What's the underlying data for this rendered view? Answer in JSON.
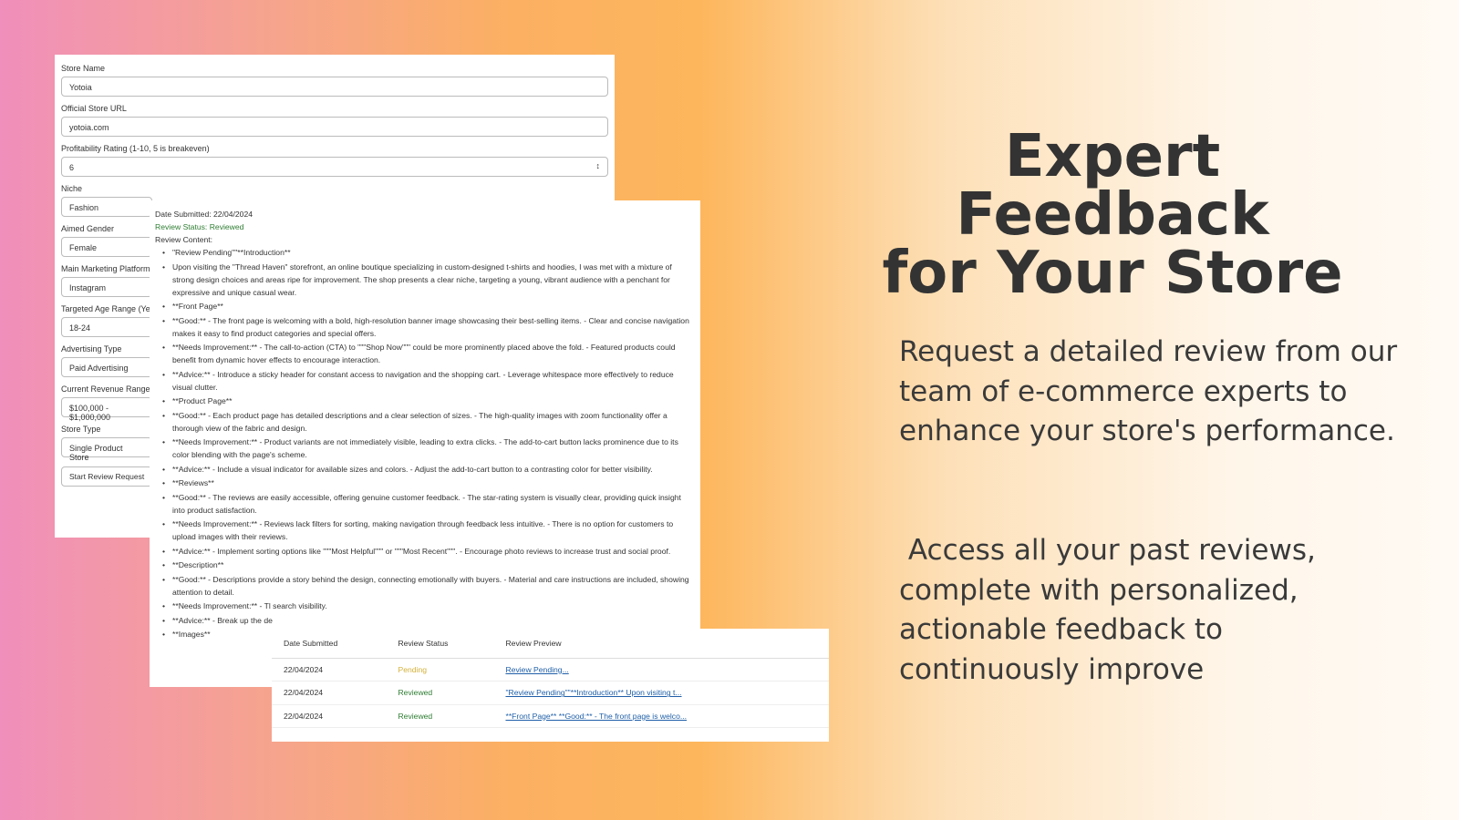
{
  "form": {
    "fields": [
      {
        "label": "Store Name",
        "value": "Yotoia"
      },
      {
        "label": "Official Store URL",
        "value": "yotoia.com"
      },
      {
        "label": "Profitability Rating (1-10, 5 is breakeven)",
        "value": "6"
      },
      {
        "label": "Niche",
        "value": "Fashion"
      },
      {
        "label": "Aimed Gender",
        "value": "Female"
      },
      {
        "label": "Main Marketing Platform",
        "value": "Instagram"
      },
      {
        "label": "Targeted Age Range (Ye",
        "value": "18-24"
      },
      {
        "label": "Advertising Type",
        "value": "Paid Advertising"
      },
      {
        "label": "Current Revenue Range",
        "value": "$100,000 - $1,000,000"
      },
      {
        "label": "Store Type",
        "value": "Single Product Store"
      }
    ],
    "submit_label": "Start Review Request"
  },
  "review": {
    "date": "Date Submitted: 22/04/2024",
    "status": "Review Status: Reviewed",
    "content_label": "Review Content:",
    "items": [
      "\"Review Pending\"\"**Introduction**",
      "Upon visiting the \"Thread Haven\" storefront, an online boutique specializing in custom-designed t-shirts and hoodies, I was met with a mixture of strong design choices and areas ripe for improvement. The shop presents a clear niche, targeting a young, vibrant audience with a penchant for expressive and unique casual wear.",
      "**Front Page**",
      "**Good:** - The front page is welcoming with a bold, high-resolution banner image showcasing their best-selling items. - Clear and concise navigation makes it easy to find product categories and special offers.",
      "**Needs Improvement:** - The call-to-action (CTA) to \"\"\"Shop Now\"\"\" could be more prominently placed above the fold. - Featured products could benefit from dynamic hover effects to encourage interaction.",
      "**Advice:** - Introduce a sticky header for constant access to navigation and the shopping cart. - Leverage whitespace more effectively to reduce visual clutter.",
      "**Product Page**",
      "**Good:** - Each product page has detailed descriptions and a clear selection of sizes. - The high-quality images with zoom functionality offer a thorough view of the fabric and design.",
      "**Needs Improvement:** - Product variants are not immediately visible, leading to extra clicks. - The add-to-cart button lacks prominence due to its color blending with the page's scheme.",
      "**Advice:** - Include a visual indicator for available sizes and colors. - Adjust the add-to-cart button to a contrasting color for better visibility.",
      "**Reviews**",
      "**Good:** - The reviews are easily accessible, offering genuine customer feedback. - The star-rating system is visually clear, providing quick insight into product satisfaction.",
      "**Needs Improvement:** - Reviews lack filters for sorting, making navigation through feedback less intuitive. - There is no option for customers to upload images with their reviews.",
      "**Advice:** - Implement sorting options like \"\"\"Most Helpful\"\"\" or \"\"\"Most Recent\"\"\". - Encourage photo reviews to increase trust and social proof.",
      "**Description**",
      "**Good:** - Descriptions provide a story behind the design, connecting emotionally with buyers. - Material and care instructions are included, showing attention to detail.",
      "**Needs Improvement:** - Tl search visibility.",
      "**Advice:** - Break up the de",
      "**Images**"
    ]
  },
  "table": {
    "headers": [
      "Date Submitted",
      "Review Status",
      "Review Preview"
    ],
    "rows": [
      {
        "date": "22/04/2024",
        "status": "Pending",
        "preview": "Review Pending..."
      },
      {
        "date": "22/04/2024",
        "status": "Reviewed",
        "preview": "\"Review Pending\"\"**Introduction** Upon visiting t..."
      },
      {
        "date": "22/04/2024",
        "status": "Reviewed",
        "preview": "**Front Page** **Good:** - The front page is welco..."
      }
    ]
  },
  "hero": {
    "title_line1": "Expert Feedback",
    "title_line2": "for Your Store",
    "paragraph1": "Request a detailed review from our team of e-commerce experts to enhance your store's performance.",
    "paragraph2": " Access all your past reviews, complete with personalized, actionable feedback to continuously improve"
  },
  "colors": {
    "reviewed": "#2e7d32",
    "pending": "#d4b13a",
    "link": "#1f5fa8"
  }
}
